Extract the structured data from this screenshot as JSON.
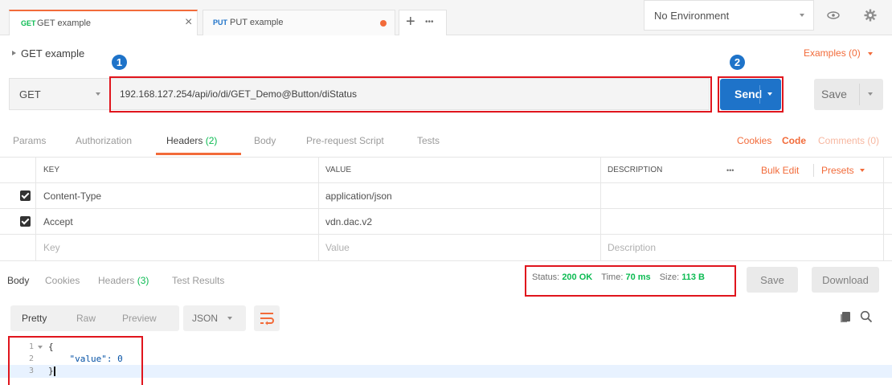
{
  "tabs": [
    {
      "method": "GET",
      "name": "GET example",
      "close": "×"
    },
    {
      "method": "PUT",
      "name": "PUT example"
    }
  ],
  "tab_actions": {
    "add": "+",
    "more": "•••"
  },
  "environment": {
    "selected": "No Environment"
  },
  "request": {
    "title": "GET example",
    "examples": "Examples (0)",
    "method": "GET",
    "url": "192.168.127.254/api/io/di/GET_Demo@Button/diStatus",
    "send": "Send",
    "save": "Save"
  },
  "annotations": {
    "one": "1",
    "two": "2"
  },
  "request_tabs": {
    "params": "Params",
    "authorization": "Authorization",
    "headers": "Headers",
    "headers_count": "(2)",
    "body": "Body",
    "prerequest": "Pre-request Script",
    "tests": "Tests",
    "cookies": "Cookies",
    "code": "Code",
    "comments": "Comments (0)"
  },
  "headers_table": {
    "columns": {
      "key": "KEY",
      "value": "VALUE",
      "description": "DESCRIPTION"
    },
    "more": "•••",
    "bulk_edit": "Bulk Edit",
    "presets": "Presets",
    "rows": [
      {
        "key": "Content-Type",
        "value": "application/json",
        "checked": true
      },
      {
        "key": "Accept",
        "value": "vdn.dac.v2",
        "checked": true
      }
    ],
    "placeholder": {
      "key": "Key",
      "value": "Value",
      "description": "Description"
    }
  },
  "response_tabs": {
    "body": "Body",
    "cookies": "Cookies",
    "headers": "Headers",
    "headers_count": "(3)",
    "test_results": "Test Results"
  },
  "status": {
    "status_label": "Status:",
    "status_value": "200 OK",
    "time_label": "Time:",
    "time_value": "70 ms",
    "size_label": "Size:",
    "size_value": "113 B"
  },
  "response_actions": {
    "save": "Save",
    "download": "Download"
  },
  "view_modes": {
    "pretty": "Pretty",
    "raw": "Raw",
    "preview": "Preview",
    "format": "JSON"
  },
  "code_lines": [
    {
      "num": "1",
      "text": "{"
    },
    {
      "num": "2",
      "text": "    \"value\": 0"
    },
    {
      "num": "3",
      "text": "}"
    }
  ]
}
